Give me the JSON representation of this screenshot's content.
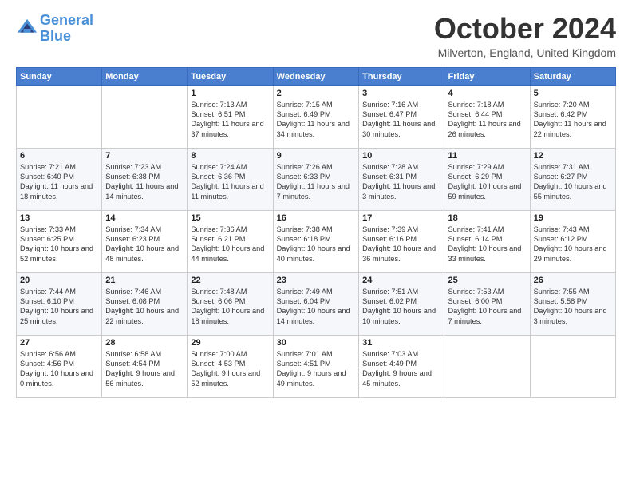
{
  "header": {
    "logo_line1": "General",
    "logo_line2": "Blue",
    "month": "October 2024",
    "location": "Milverton, England, United Kingdom"
  },
  "weekdays": [
    "Sunday",
    "Monday",
    "Tuesday",
    "Wednesday",
    "Thursday",
    "Friday",
    "Saturday"
  ],
  "weeks": [
    [
      {
        "day": "",
        "sunrise": "",
        "sunset": "",
        "daylight": ""
      },
      {
        "day": "",
        "sunrise": "",
        "sunset": "",
        "daylight": ""
      },
      {
        "day": "1",
        "sunrise": "Sunrise: 7:13 AM",
        "sunset": "Sunset: 6:51 PM",
        "daylight": "Daylight: 11 hours and 37 minutes."
      },
      {
        "day": "2",
        "sunrise": "Sunrise: 7:15 AM",
        "sunset": "Sunset: 6:49 PM",
        "daylight": "Daylight: 11 hours and 34 minutes."
      },
      {
        "day": "3",
        "sunrise": "Sunrise: 7:16 AM",
        "sunset": "Sunset: 6:47 PM",
        "daylight": "Daylight: 11 hours and 30 minutes."
      },
      {
        "day": "4",
        "sunrise": "Sunrise: 7:18 AM",
        "sunset": "Sunset: 6:44 PM",
        "daylight": "Daylight: 11 hours and 26 minutes."
      },
      {
        "day": "5",
        "sunrise": "Sunrise: 7:20 AM",
        "sunset": "Sunset: 6:42 PM",
        "daylight": "Daylight: 11 hours and 22 minutes."
      }
    ],
    [
      {
        "day": "6",
        "sunrise": "Sunrise: 7:21 AM",
        "sunset": "Sunset: 6:40 PM",
        "daylight": "Daylight: 11 hours and 18 minutes."
      },
      {
        "day": "7",
        "sunrise": "Sunrise: 7:23 AM",
        "sunset": "Sunset: 6:38 PM",
        "daylight": "Daylight: 11 hours and 14 minutes."
      },
      {
        "day": "8",
        "sunrise": "Sunrise: 7:24 AM",
        "sunset": "Sunset: 6:36 PM",
        "daylight": "Daylight: 11 hours and 11 minutes."
      },
      {
        "day": "9",
        "sunrise": "Sunrise: 7:26 AM",
        "sunset": "Sunset: 6:33 PM",
        "daylight": "Daylight: 11 hours and 7 minutes."
      },
      {
        "day": "10",
        "sunrise": "Sunrise: 7:28 AM",
        "sunset": "Sunset: 6:31 PM",
        "daylight": "Daylight: 11 hours and 3 minutes."
      },
      {
        "day": "11",
        "sunrise": "Sunrise: 7:29 AM",
        "sunset": "Sunset: 6:29 PM",
        "daylight": "Daylight: 10 hours and 59 minutes."
      },
      {
        "day": "12",
        "sunrise": "Sunrise: 7:31 AM",
        "sunset": "Sunset: 6:27 PM",
        "daylight": "Daylight: 10 hours and 55 minutes."
      }
    ],
    [
      {
        "day": "13",
        "sunrise": "Sunrise: 7:33 AM",
        "sunset": "Sunset: 6:25 PM",
        "daylight": "Daylight: 10 hours and 52 minutes."
      },
      {
        "day": "14",
        "sunrise": "Sunrise: 7:34 AM",
        "sunset": "Sunset: 6:23 PM",
        "daylight": "Daylight: 10 hours and 48 minutes."
      },
      {
        "day": "15",
        "sunrise": "Sunrise: 7:36 AM",
        "sunset": "Sunset: 6:21 PM",
        "daylight": "Daylight: 10 hours and 44 minutes."
      },
      {
        "day": "16",
        "sunrise": "Sunrise: 7:38 AM",
        "sunset": "Sunset: 6:18 PM",
        "daylight": "Daylight: 10 hours and 40 minutes."
      },
      {
        "day": "17",
        "sunrise": "Sunrise: 7:39 AM",
        "sunset": "Sunset: 6:16 PM",
        "daylight": "Daylight: 10 hours and 36 minutes."
      },
      {
        "day": "18",
        "sunrise": "Sunrise: 7:41 AM",
        "sunset": "Sunset: 6:14 PM",
        "daylight": "Daylight: 10 hours and 33 minutes."
      },
      {
        "day": "19",
        "sunrise": "Sunrise: 7:43 AM",
        "sunset": "Sunset: 6:12 PM",
        "daylight": "Daylight: 10 hours and 29 minutes."
      }
    ],
    [
      {
        "day": "20",
        "sunrise": "Sunrise: 7:44 AM",
        "sunset": "Sunset: 6:10 PM",
        "daylight": "Daylight: 10 hours and 25 minutes."
      },
      {
        "day": "21",
        "sunrise": "Sunrise: 7:46 AM",
        "sunset": "Sunset: 6:08 PM",
        "daylight": "Daylight: 10 hours and 22 minutes."
      },
      {
        "day": "22",
        "sunrise": "Sunrise: 7:48 AM",
        "sunset": "Sunset: 6:06 PM",
        "daylight": "Daylight: 10 hours and 18 minutes."
      },
      {
        "day": "23",
        "sunrise": "Sunrise: 7:49 AM",
        "sunset": "Sunset: 6:04 PM",
        "daylight": "Daylight: 10 hours and 14 minutes."
      },
      {
        "day": "24",
        "sunrise": "Sunrise: 7:51 AM",
        "sunset": "Sunset: 6:02 PM",
        "daylight": "Daylight: 10 hours and 10 minutes."
      },
      {
        "day": "25",
        "sunrise": "Sunrise: 7:53 AM",
        "sunset": "Sunset: 6:00 PM",
        "daylight": "Daylight: 10 hours and 7 minutes."
      },
      {
        "day": "26",
        "sunrise": "Sunrise: 7:55 AM",
        "sunset": "Sunset: 5:58 PM",
        "daylight": "Daylight: 10 hours and 3 minutes."
      }
    ],
    [
      {
        "day": "27",
        "sunrise": "Sunrise: 6:56 AM",
        "sunset": "Sunset: 4:56 PM",
        "daylight": "Daylight: 10 hours and 0 minutes."
      },
      {
        "day": "28",
        "sunrise": "Sunrise: 6:58 AM",
        "sunset": "Sunset: 4:54 PM",
        "daylight": "Daylight: 9 hours and 56 minutes."
      },
      {
        "day": "29",
        "sunrise": "Sunrise: 7:00 AM",
        "sunset": "Sunset: 4:53 PM",
        "daylight": "Daylight: 9 hours and 52 minutes."
      },
      {
        "day": "30",
        "sunrise": "Sunrise: 7:01 AM",
        "sunset": "Sunset: 4:51 PM",
        "daylight": "Daylight: 9 hours and 49 minutes."
      },
      {
        "day": "31",
        "sunrise": "Sunrise: 7:03 AM",
        "sunset": "Sunset: 4:49 PM",
        "daylight": "Daylight: 9 hours and 45 minutes."
      },
      {
        "day": "",
        "sunrise": "",
        "sunset": "",
        "daylight": ""
      },
      {
        "day": "",
        "sunrise": "",
        "sunset": "",
        "daylight": ""
      }
    ]
  ]
}
